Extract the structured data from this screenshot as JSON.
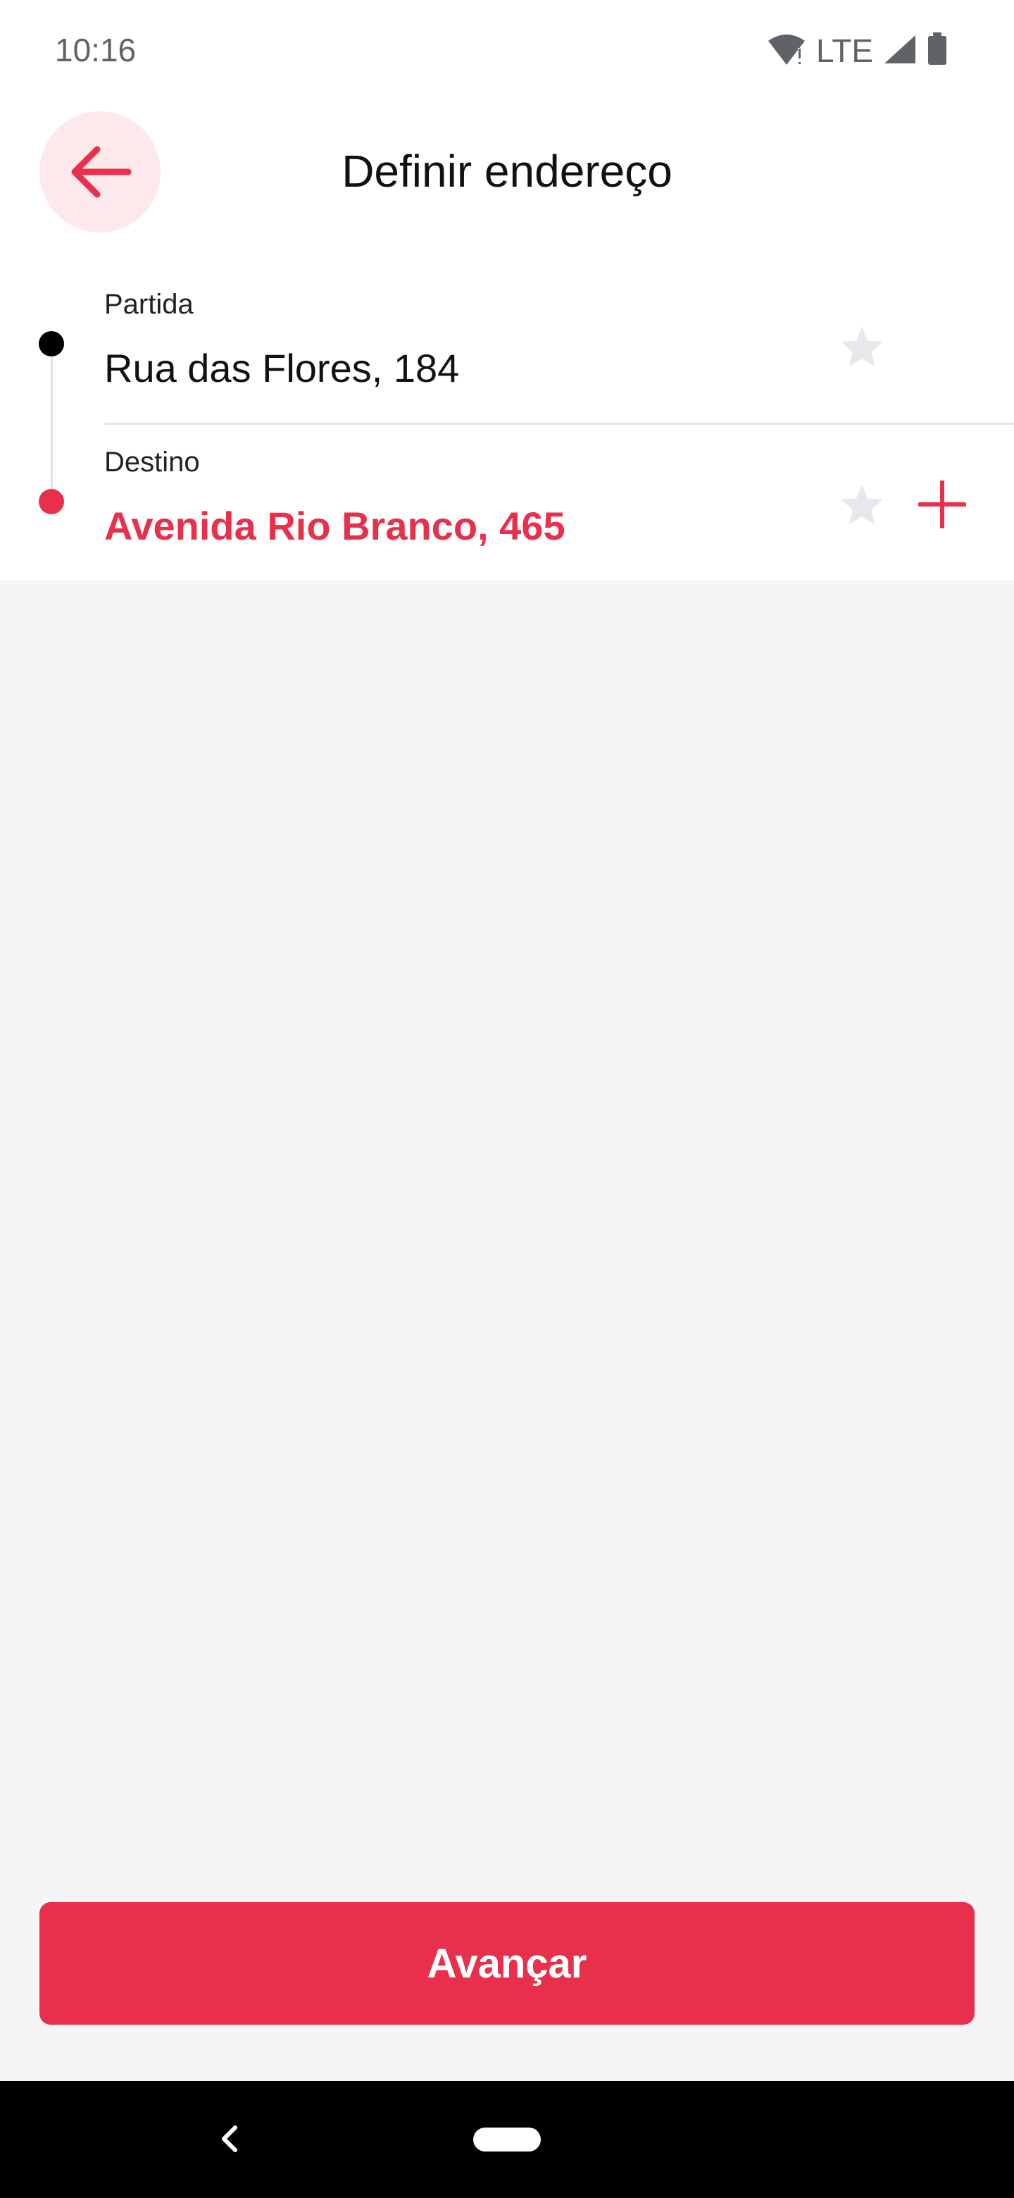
{
  "status_bar": {
    "time": "10:16",
    "network_label": "LTE",
    "icons": [
      "wifi-icon",
      "signal-icon",
      "battery-icon"
    ]
  },
  "header": {
    "title": "Definir endereço",
    "back_icon": "arrow-left-icon"
  },
  "route": {
    "origin": {
      "label": "Partida",
      "value": "Rua das Flores, 184"
    },
    "destination": {
      "label": "Destino",
      "value": "Avenida Rio Branco, 465"
    }
  },
  "actions": {
    "primary_label": "Avançar"
  },
  "colors": {
    "accent": "#e8304c",
    "back_button_bg": "#fde8eb",
    "star_inactive": "#e6e8ec",
    "background": "#f5f4f7"
  }
}
